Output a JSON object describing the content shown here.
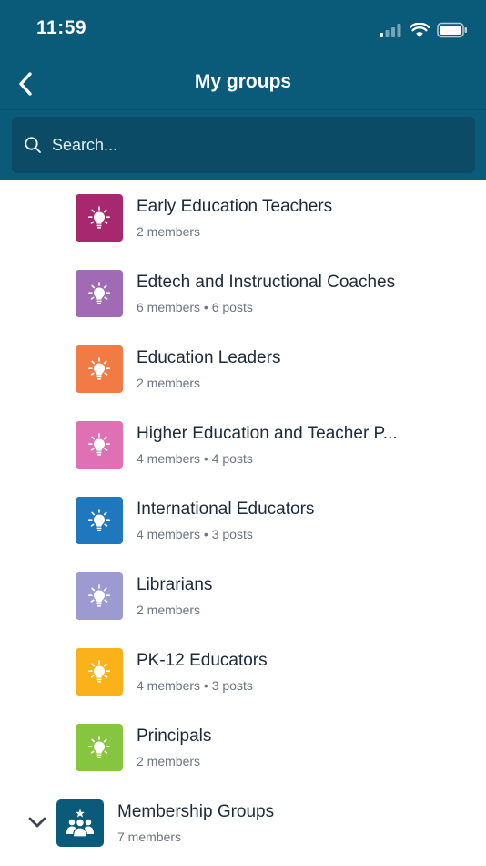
{
  "status_bar": {
    "time": "11:59"
  },
  "nav": {
    "title": "My groups"
  },
  "search": {
    "placeholder": "Search..."
  },
  "groups": [
    {
      "name": "Early Education Teachers",
      "meta": "2 members",
      "color": "#a7286f"
    },
    {
      "name": "Edtech and Instructional Coaches",
      "meta": "6 members • 6 posts",
      "color": "#a06ab4"
    },
    {
      "name": "Education Leaders",
      "meta": "2 members",
      "color": "#f27a45"
    },
    {
      "name": "Higher Education and Teacher P...",
      "meta": "4 members • 4 posts",
      "color": "#e070b4"
    },
    {
      "name": "International Educators",
      "meta": "4 members • 3 posts",
      "color": "#1f78be"
    },
    {
      "name": "Librarians",
      "meta": "2 members",
      "color": "#9c9ad0"
    },
    {
      "name": "PK-12 Educators",
      "meta": "4 members • 3 posts",
      "color": "#fbb21a"
    },
    {
      "name": "Principals",
      "meta": "2 members",
      "color": "#86c540"
    }
  ],
  "parent_group": {
    "name": "Membership Groups",
    "meta": "7 members",
    "color": "#0a5a7a"
  },
  "colors": {
    "header": "#0a5a7a",
    "search_bg": "#0b4b66"
  }
}
